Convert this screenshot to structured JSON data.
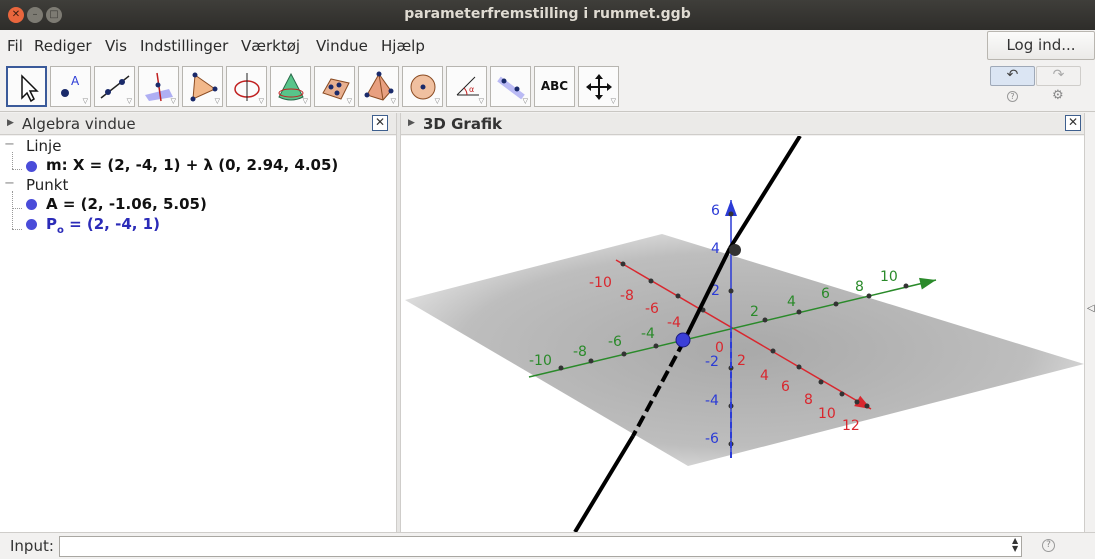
{
  "window": {
    "title": "parameterfremstilling i rummet.ggb",
    "close_glyph": "✕",
    "min_glyph": "–",
    "max_glyph": "□"
  },
  "menu": {
    "items": [
      "Fil",
      "Rediger",
      "Vis",
      "Indstillinger",
      "Værktøj",
      "Vindue",
      "Hjælp"
    ],
    "login": "Log ind..."
  },
  "toolbar": {
    "tools": [
      {
        "icon": "move-arrow-icon"
      },
      {
        "icon": "point-icon"
      },
      {
        "icon": "line-icon"
      },
      {
        "icon": "perpendicular-line-icon"
      },
      {
        "icon": "polygon-icon"
      },
      {
        "icon": "circle-axis-icon"
      },
      {
        "icon": "cone-intersection-icon"
      },
      {
        "icon": "plane-points-icon"
      },
      {
        "icon": "pyramid-icon"
      },
      {
        "icon": "sphere-icon"
      },
      {
        "icon": "angle-icon"
      },
      {
        "icon": "reflect-icon"
      },
      {
        "icon": "text-icon",
        "label": "ABC"
      },
      {
        "icon": "move-view-icon"
      }
    ],
    "undo_glyph": "↶",
    "redo_glyph": "↷",
    "help_glyph": "?",
    "gear_glyph": "⚙"
  },
  "algebra": {
    "title": "Algebra vindue",
    "close_glyph": "✕",
    "toggle_glyph": "−",
    "groups": [
      {
        "label": "Linje",
        "items": [
          {
            "text": "m: X = (2, -4, 1) + λ (0, 2.94, 4.05)",
            "color": "#4a4cd9",
            "text_color": "#111111"
          }
        ]
      },
      {
        "label": "Punkt",
        "items": [
          {
            "text": "A = (2, -1.06, 5.05)",
            "color": "#4a4cd9",
            "text_color": "#111111"
          },
          {
            "text": "P",
            "sub": "o",
            "rest": " = (2, -4, 1)",
            "color": "#4a4cd9",
            "text_color": "#2b2bb8"
          }
        ]
      }
    ]
  },
  "graphics": {
    "title": "3D Grafik",
    "close_glyph": "✕",
    "x_axis": {
      "color": "#d9272e",
      "ticks": [
        "-10",
        "-8",
        "-6",
        "-4",
        "2",
        "4",
        "6",
        "8",
        "10",
        "12"
      ]
    },
    "y_axis": {
      "color": "#2a8a2a",
      "ticks": [
        "-10",
        "-8",
        "-6",
        "-4",
        "2",
        "4",
        "6",
        "8",
        "10"
      ]
    },
    "z_axis": {
      "color": "#2b3bd6",
      "ticks": [
        "6",
        "4",
        "2",
        "-2",
        "-4",
        "-6"
      ]
    },
    "origin_label": "0",
    "line_color": "#000000",
    "point_color": "#3b3fd8",
    "point_A_color": "#333333"
  },
  "input": {
    "label": "Input:",
    "value": "",
    "help_glyph": "?"
  }
}
